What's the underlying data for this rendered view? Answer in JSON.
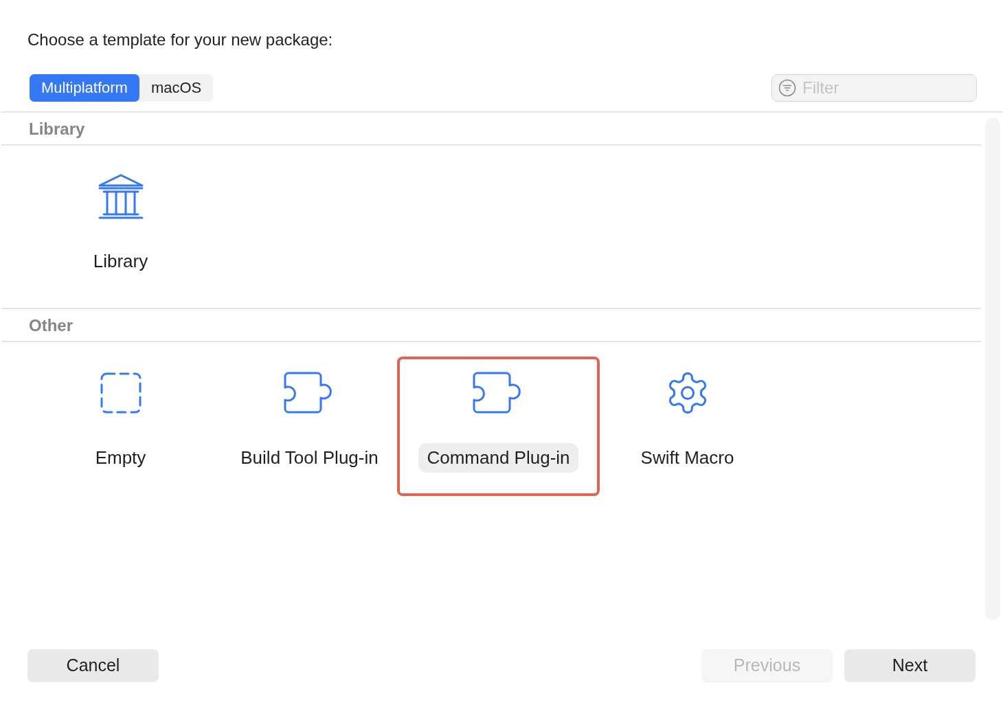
{
  "prompt": "Choose a template for your new package:",
  "platform_tabs": [
    {
      "label": "Multiplatform",
      "selected": true
    },
    {
      "label": "macOS",
      "selected": false
    }
  ],
  "filter": {
    "placeholder": "Filter"
  },
  "sections": [
    {
      "title": "Library",
      "templates": [
        {
          "name": "Library",
          "kind": "library",
          "selected": false,
          "highlighted": false
        }
      ]
    },
    {
      "title": "Other",
      "templates": [
        {
          "name": "Empty",
          "kind": "empty",
          "selected": false,
          "highlighted": false
        },
        {
          "name": "Build Tool Plug-in",
          "kind": "puzzle",
          "selected": false,
          "highlighted": false
        },
        {
          "name": "Command Plug-in",
          "kind": "puzzle",
          "selected": true,
          "highlighted": true
        },
        {
          "name": "Swift Macro",
          "kind": "gear",
          "selected": false,
          "highlighted": false
        }
      ]
    }
  ],
  "buttons": [
    {
      "label": "Cancel",
      "disabled": false
    },
    {
      "label": "Previous",
      "disabled": true
    },
    {
      "label": "Next",
      "disabled": false
    }
  ]
}
